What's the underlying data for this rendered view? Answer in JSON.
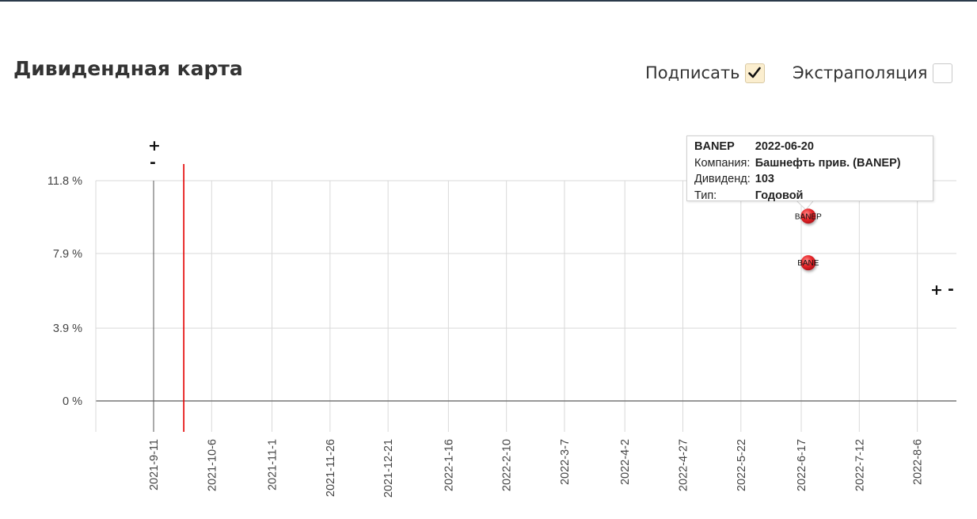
{
  "header": {
    "title": "Дивидендная карта",
    "sign_label": "Подписать",
    "sign_checked": true,
    "extrapolation_label": "Экстраполяция",
    "extrapolation_checked": false
  },
  "zoom": {
    "y_plus": "+",
    "y_minus": "-",
    "x_plus": "+",
    "x_minus": "-"
  },
  "tooltip": {
    "ticker": "BANEP",
    "date": "2022-06-20",
    "company_label": "Компания:",
    "company": "Башнефть прив. (BANEP)",
    "dividend_label": "Дивиденд:",
    "dividend": "103",
    "type_label": "Тип:",
    "type": "Годовой"
  },
  "chart_data": {
    "type": "scatter",
    "y_unit": "%",
    "y_ticks": [
      0,
      3.9,
      7.9,
      11.8
    ],
    "y_tick_labels": [
      "0 %",
      "3.9 %",
      "7.9 %",
      "11.8 %"
    ],
    "ylim": [
      -1.7,
      11.8
    ],
    "x_ticks": [
      "2021-9-11",
      "2021-10-6",
      "2021-11-1",
      "2021-11-26",
      "2021-12-21",
      "2022-1-16",
      "2022-2-10",
      "2022-3-7",
      "2022-4-2",
      "2022-4-27",
      "2022-5-22",
      "2022-6-17",
      "2022-7-12",
      "2022-8-6"
    ],
    "xlim": [
      "2021-8-22",
      "2022-9-1"
    ],
    "today_marker": "2021-9-24",
    "grid": true,
    "points": [
      {
        "label": "BANEP",
        "date": "2022-06-20",
        "y": 9.9,
        "color": "#e8272a"
      },
      {
        "label": "BANE",
        "date": "2022-06-20",
        "y": 7.4,
        "color": "#e8272a"
      }
    ]
  },
  "colors": {
    "grid": "#d9d9d9",
    "axis": "#777777",
    "today_line": "#e30000",
    "point": "#e8272a"
  }
}
